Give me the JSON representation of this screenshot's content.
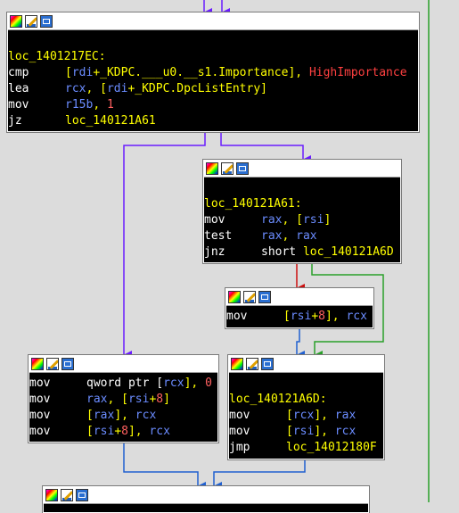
{
  "colors": {
    "background": "#dcdcdc",
    "node_bg": "#000000",
    "label_yellow": "#ffff00",
    "register_blue": "#6b8cff",
    "number_red": "#ff6060",
    "edge_purple": "#6a1cff",
    "edge_blue": "#2060d0",
    "edge_red": "#cc1010",
    "edge_green": "#2aa02a"
  },
  "header_icons": [
    "color-palette-icon",
    "rename-icon",
    "graph-view-icon"
  ],
  "nodes": {
    "n0": {
      "label": "loc_1401217EC:",
      "lines": [
        {
          "mn": "cmp",
          "ops": [
            {
              "t": "[",
              "c": "op"
            },
            {
              "t": "rdi",
              "c": "reg"
            },
            {
              "t": "+_KDPC.___u0.__s1.Importance], ",
              "c": "op"
            },
            {
              "t": "HighImportance",
              "c": "cst"
            }
          ]
        },
        {
          "mn": "lea",
          "ops": [
            {
              "t": "rcx",
              "c": "reg"
            },
            {
              "t": ", [",
              "c": "op"
            },
            {
              "t": "rdi",
              "c": "reg"
            },
            {
              "t": "+_KDPC.DpcListEntry]",
              "c": "op"
            }
          ]
        },
        {
          "mn": "mov",
          "ops": [
            {
              "t": "r15b",
              "c": "reg"
            },
            {
              "t": ", ",
              "c": "op"
            },
            {
              "t": "1",
              "c": "num"
            }
          ]
        },
        {
          "mn": "jz",
          "ops": [
            {
              "t": "loc_140121A61",
              "c": "op"
            }
          ]
        }
      ]
    },
    "n1": {
      "label": "loc_140121A61:",
      "lines": [
        {
          "mn": "mov",
          "ops": [
            {
              "t": "rax",
              "c": "reg"
            },
            {
              "t": ", [",
              "c": "op"
            },
            {
              "t": "rsi",
              "c": "reg"
            },
            {
              "t": "]",
              "c": "op"
            }
          ]
        },
        {
          "mn": "test",
          "ops": [
            {
              "t": "rax",
              "c": "reg"
            },
            {
              "t": ", ",
              "c": "op"
            },
            {
              "t": "rax",
              "c": "reg"
            }
          ]
        },
        {
          "mn": "jnz",
          "ops": [
            {
              "t": "short ",
              "c": "mnw"
            },
            {
              "t": "loc_140121A6D",
              "c": "op"
            }
          ]
        }
      ]
    },
    "n2": {
      "label": "",
      "lines": [
        {
          "mn": "mov",
          "ops": [
            {
              "t": "[",
              "c": "op"
            },
            {
              "t": "rsi",
              "c": "reg"
            },
            {
              "t": "+",
              "c": "op"
            },
            {
              "t": "8",
              "c": "num"
            },
            {
              "t": "], ",
              "c": "op"
            },
            {
              "t": "rcx",
              "c": "reg"
            }
          ]
        }
      ]
    },
    "n3": {
      "label": "",
      "lines": [
        {
          "mn": "mov",
          "ops": [
            {
              "t": "qword ptr [",
              "c": "mnw"
            },
            {
              "t": "rcx",
              "c": "reg"
            },
            {
              "t": "], ",
              "c": "op"
            },
            {
              "t": "0",
              "c": "num"
            }
          ]
        },
        {
          "mn": "mov",
          "ops": [
            {
              "t": "rax",
              "c": "reg"
            },
            {
              "t": ", [",
              "c": "op"
            },
            {
              "t": "rsi",
              "c": "reg"
            },
            {
              "t": "+",
              "c": "op"
            },
            {
              "t": "8",
              "c": "num"
            },
            {
              "t": "]",
              "c": "op"
            }
          ]
        },
        {
          "mn": "mov",
          "ops": [
            {
              "t": "[",
              "c": "op"
            },
            {
              "t": "rax",
              "c": "reg"
            },
            {
              "t": "], ",
              "c": "op"
            },
            {
              "t": "rcx",
              "c": "reg"
            }
          ]
        },
        {
          "mn": "mov",
          "ops": [
            {
              "t": "[",
              "c": "op"
            },
            {
              "t": "rsi",
              "c": "reg"
            },
            {
              "t": "+",
              "c": "op"
            },
            {
              "t": "8",
              "c": "num"
            },
            {
              "t": "], ",
              "c": "op"
            },
            {
              "t": "rcx",
              "c": "reg"
            }
          ]
        }
      ]
    },
    "n4": {
      "label": "loc_140121A6D:",
      "lines": [
        {
          "mn": "mov",
          "ops": [
            {
              "t": "[",
              "c": "op"
            },
            {
              "t": "rcx",
              "c": "reg"
            },
            {
              "t": "], ",
              "c": "op"
            },
            {
              "t": "rax",
              "c": "reg"
            }
          ]
        },
        {
          "mn": "mov",
          "ops": [
            {
              "t": "[",
              "c": "op"
            },
            {
              "t": "rsi",
              "c": "reg"
            },
            {
              "t": "], ",
              "c": "op"
            },
            {
              "t": "rcx",
              "c": "reg"
            }
          ]
        },
        {
          "mn": "jmp",
          "ops": [
            {
              "t": "loc_14012180F",
              "c": "op"
            }
          ]
        }
      ]
    },
    "n5": {
      "label": "",
      "lines": []
    }
  }
}
